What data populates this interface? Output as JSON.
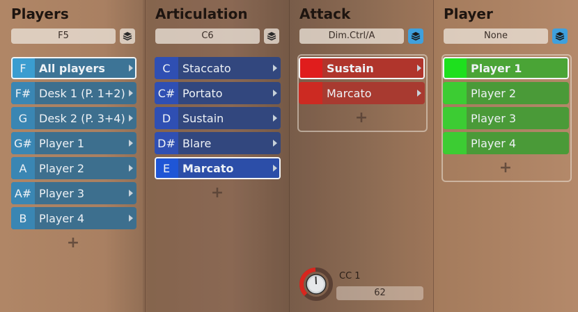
{
  "columns": {
    "players": {
      "title": "Players",
      "selector_value": "F5",
      "items": [
        {
          "key": "F",
          "label": "All players"
        },
        {
          "key": "F#",
          "label": "Desk 1 (P. 1+2)"
        },
        {
          "key": "G",
          "label": "Desk 2 (P. 3+4)"
        },
        {
          "key": "G#",
          "label": "Player 1"
        },
        {
          "key": "A",
          "label": "Player 2"
        },
        {
          "key": "A#",
          "label": "Player 3"
        },
        {
          "key": "B",
          "label": "Player 4"
        }
      ],
      "add_label": "+"
    },
    "articulation": {
      "title": "Articulation",
      "selector_value": "C6",
      "items": [
        {
          "key": "C",
          "label": "Staccato"
        },
        {
          "key": "C#",
          "label": "Portato"
        },
        {
          "key": "D",
          "label": "Sustain"
        },
        {
          "key": "D#",
          "label": "Blare"
        },
        {
          "key": "E",
          "label": "Marcato"
        }
      ],
      "add_label": "+"
    },
    "attack": {
      "title": "Attack",
      "selector_value": "Dim.Ctrl/A",
      "items": [
        {
          "label": "Sustain"
        },
        {
          "label": "Marcato"
        }
      ],
      "add_label": "+"
    },
    "player": {
      "title": "Player",
      "selector_value": "None",
      "items": [
        {
          "label": "Player 1"
        },
        {
          "label": "Player 2"
        },
        {
          "label": "Player 3"
        },
        {
          "label": "Player 4"
        }
      ],
      "add_label": "+"
    }
  },
  "cc_control": {
    "label": "CC 1",
    "value": "62",
    "knob_level": 0.49
  },
  "colors": {
    "players_item": "#3d6f8e",
    "players_key": "#3b9dd0",
    "articulation_item": "#32477e",
    "articulation_key": "#2f4fb3",
    "articulation_selected": "#1f56d6",
    "attack_item": "#a83a30",
    "attack_key": "#e01d1d",
    "player_item": "#4a9a38",
    "player_key": "#3ccc33",
    "player_selected_key": "#1ee01e",
    "stack_active": "#3fa0dd",
    "knob_arc": "#d8261e"
  },
  "icons": {
    "stack": "layers-icon",
    "chevron": "chevron-right-icon",
    "add": "plus-icon",
    "knob": "knob-icon"
  }
}
